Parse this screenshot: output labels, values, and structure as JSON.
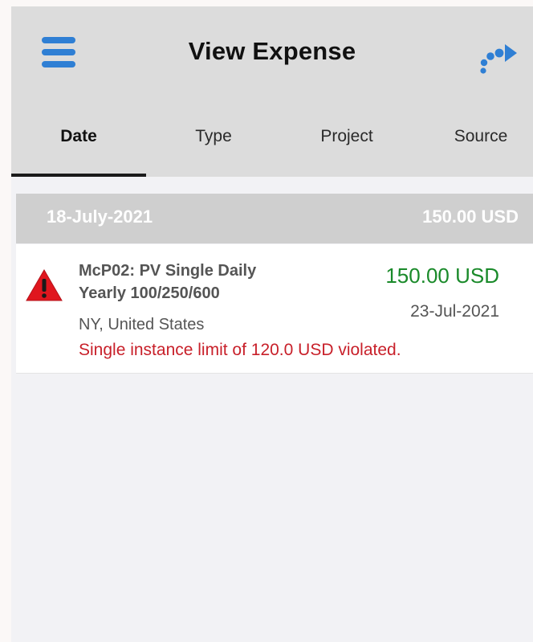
{
  "header": {
    "title": "View Expense",
    "menu_icon": "hamburger-menu-icon",
    "logout_icon": "logout-arrow-icon",
    "accent_color": "#2f7fd4"
  },
  "tabs": [
    {
      "label": "Date",
      "active": true
    },
    {
      "label": "Type",
      "active": false
    },
    {
      "label": "Project",
      "active": false
    },
    {
      "label": "Source",
      "active": false
    }
  ],
  "groups": [
    {
      "date": "18-July-2021",
      "total": "150.00 USD",
      "expenses": [
        {
          "title_line1": "McP02: PV Single Daily",
          "title_line2": "Yearly 100/250/600",
          "location": "NY, United States",
          "amount": "150.00 USD",
          "date": "23-Jul-2021",
          "violation": "Single instance limit of 120.0 USD violated.",
          "status_icon": "warning-triangle-icon"
        }
      ]
    }
  ],
  "colors": {
    "amount": "#1a8a2a",
    "violation": "#c8202a",
    "warning": "#e0161e"
  }
}
